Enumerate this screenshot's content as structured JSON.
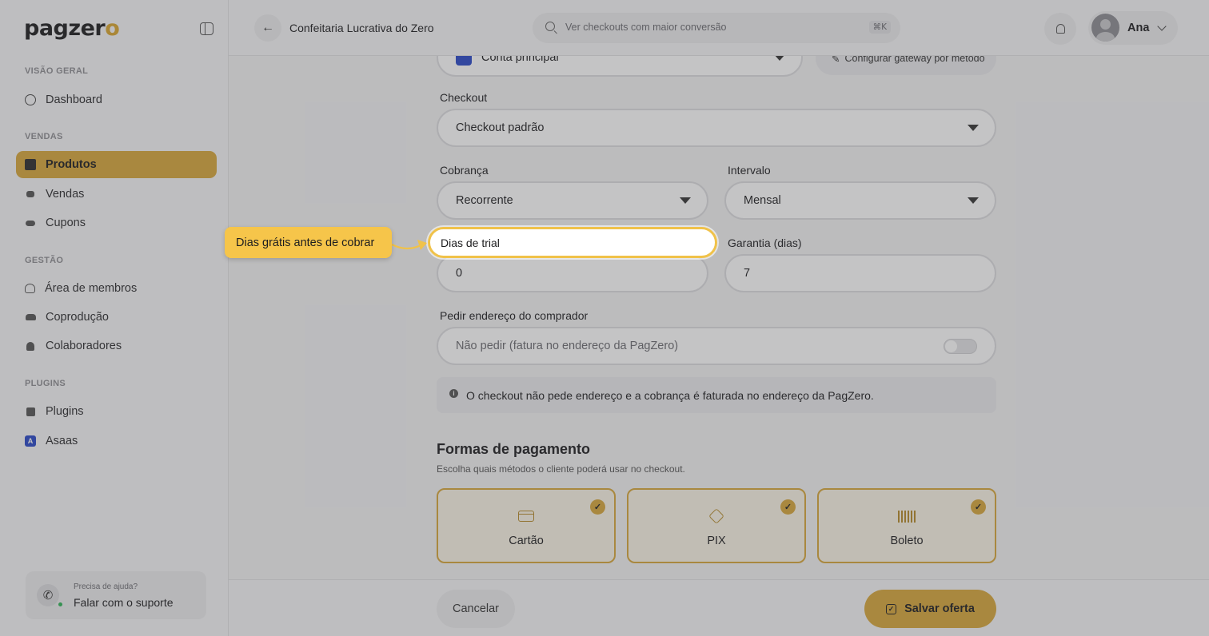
{
  "brand": {
    "logo_text": "pagzer",
    "logo_accent": "o",
    "accent_color": "#d8a73a"
  },
  "sidebar": {
    "sections": [
      {
        "label": "VISÃO GERAL",
        "items": [
          {
            "label": "Dashboard",
            "icon": "pie-chart-icon"
          }
        ]
      },
      {
        "label": "VENDAS",
        "items": [
          {
            "label": "Produtos",
            "icon": "box-icon",
            "active": true
          },
          {
            "label": "Vendas",
            "icon": "hand-coin-icon"
          },
          {
            "label": "Cupons",
            "icon": "ticket-icon"
          }
        ]
      },
      {
        "label": "GESTÃO",
        "items": [
          {
            "label": "Área de membros",
            "icon": "users-icon"
          },
          {
            "label": "Coprodução",
            "icon": "handshake-icon"
          },
          {
            "label": "Colaboradores",
            "icon": "person-icon"
          }
        ]
      },
      {
        "label": "PLUGINS",
        "items": [
          {
            "label": "Plugins",
            "icon": "puzzle-icon"
          },
          {
            "label": "Asaas",
            "icon": "asaas-logo-icon"
          }
        ]
      }
    ],
    "help": {
      "title": "Precisa de ajuda?",
      "link": "Falar com o suporte"
    }
  },
  "header": {
    "title": "Confeitaria Lucrativa do Zero",
    "search": {
      "placeholder": "Ver checkouts com maior conversão",
      "shortcut": "⌘K"
    },
    "user": {
      "name": "Ana"
    }
  },
  "form": {
    "account": {
      "value": "Conta principal"
    },
    "gateway_button": "Configurar gateway por método",
    "checkout": {
      "label": "Checkout",
      "value": "Checkout padrão"
    },
    "cobranca": {
      "label": "Cobrança",
      "value": "Recorrente"
    },
    "intervalo": {
      "label": "Intervalo",
      "value": "Mensal"
    },
    "trial": {
      "label": "Dias de trial",
      "value": "0"
    },
    "garantia": {
      "label": "Garantia (dias)",
      "value": "7"
    },
    "endereco": {
      "label": "Pedir endereço do comprador",
      "value": "Não pedir (fatura no endereço da PagZero)",
      "toggle_on": false
    },
    "info_text": "O checkout não pede endereço e a cobrança é faturada no endereço da PagZero."
  },
  "payments": {
    "title": "Formas de pagamento",
    "subtitle": "Escolha quais métodos o cliente poderá usar no checkout.",
    "methods": [
      {
        "label": "Cartão",
        "icon": "credit-card-icon",
        "selected": true
      },
      {
        "label": "PIX",
        "icon": "pix-icon",
        "selected": true
      },
      {
        "label": "Boleto",
        "icon": "barcode-icon",
        "selected": true
      }
    ]
  },
  "footer": {
    "cancel": "Cancelar",
    "save": "Salvar oferta"
  },
  "tour": {
    "tooltip": "Dias grátis antes de cobrar",
    "highlight_label": "Dias de trial"
  }
}
